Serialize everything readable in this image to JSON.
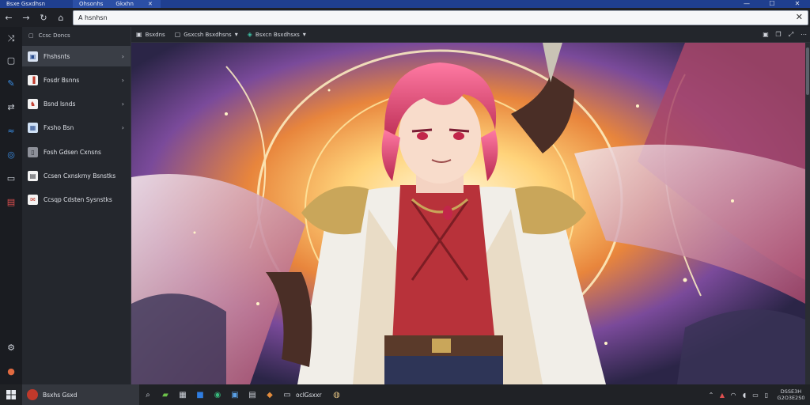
{
  "titlebar": {
    "tabs": [
      {
        "label": "Bsxe Gsxdhsn"
      },
      {
        "label": "Ohsonhs"
      },
      {
        "label": "Gkxhn"
      }
    ],
    "close_tab": "✕",
    "minimize": "—",
    "maximize": "☐",
    "close": "✕"
  },
  "nav": {
    "back": "←",
    "forward": "→",
    "refresh": "↻",
    "home": "⌂",
    "address": "A hsnhsn",
    "clear": "✕"
  },
  "panel": {
    "header": "Ccsc  Doncs",
    "items": [
      {
        "label": "Fhshsnts",
        "chevron": "›"
      },
      {
        "label": "Fosdr Bsnns",
        "chevron": "›"
      },
      {
        "label": "Bsnd lsnds",
        "chevron": "›"
      },
      {
        "label": "Fxsho Bsn",
        "chevron": "›"
      },
      {
        "label": "Fosh Gdsen Cxnsns",
        "chevron": ""
      },
      {
        "label": "Ccsen Cxnskrny Bsnstks",
        "chevron": ""
      },
      {
        "label": "Ccsqp Cdsten Sysnstks",
        "chevron": ""
      }
    ]
  },
  "toolbar": {
    "items": [
      {
        "label": "Bsxdns"
      },
      {
        "label": "Gsxcsh Bsxdhsns"
      },
      {
        "label": "Bsxcn Bsxdhsxs"
      }
    ]
  },
  "taskbar": {
    "active_app": "Bsxhs Gsxd",
    "app_label": "oclGsxxr",
    "clock_time": "DSSE3H",
    "clock_date": "G2O3E2S0"
  },
  "colors": {
    "accent": "#1f3f8f",
    "panel_bg": "#24272d",
    "selected": "#3a3e46"
  }
}
